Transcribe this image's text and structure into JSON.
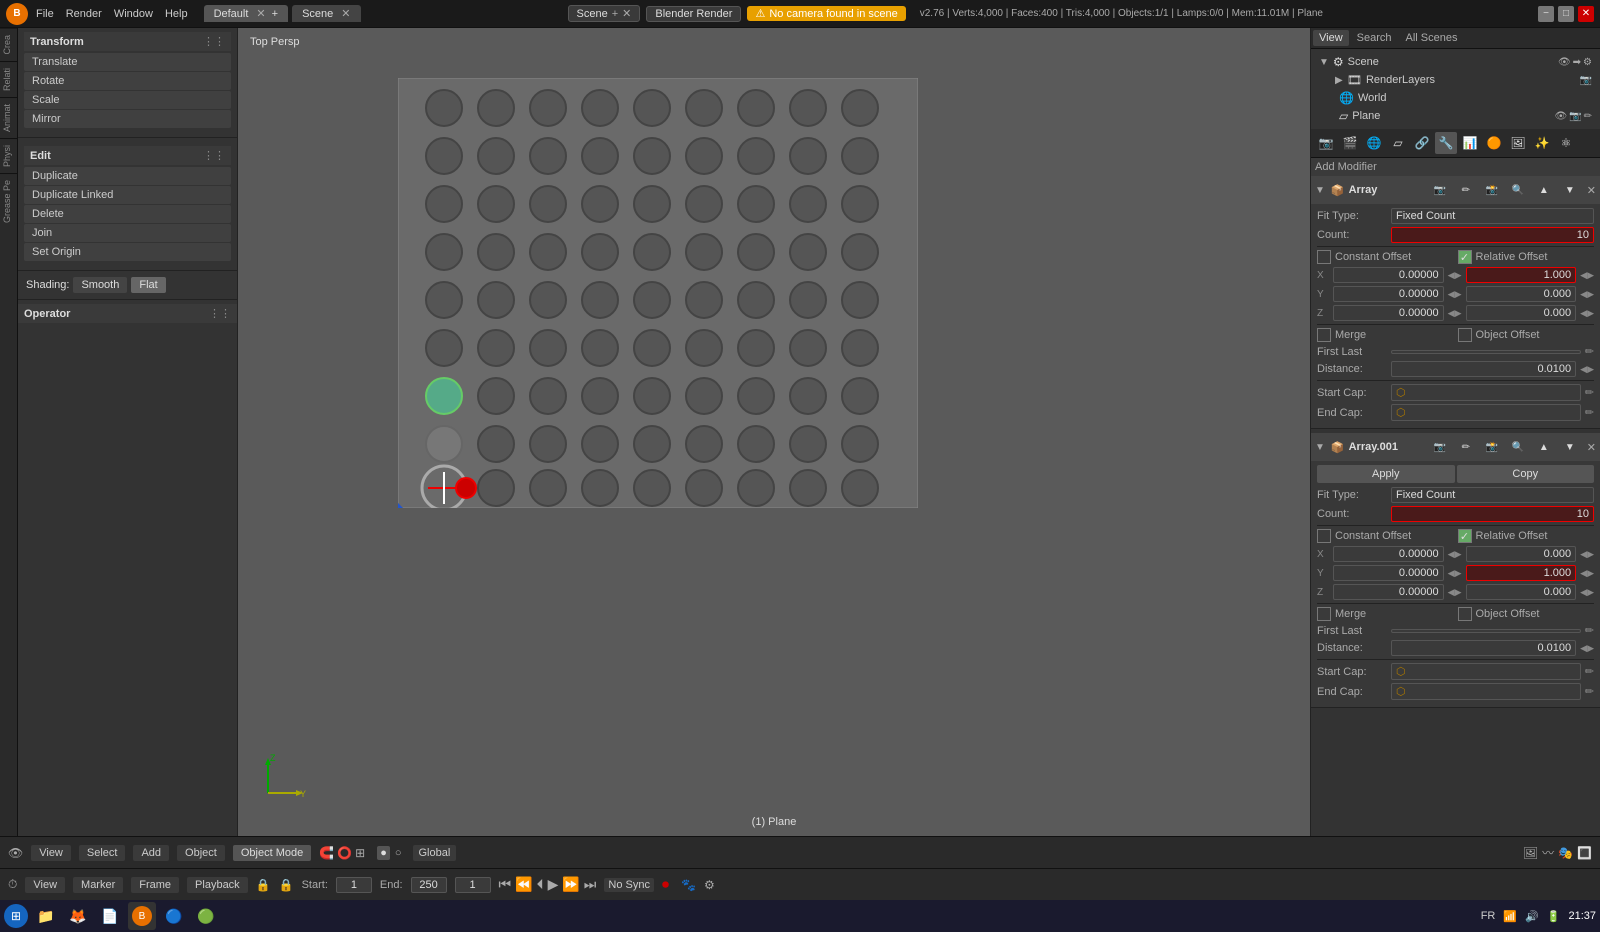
{
  "topbar": {
    "logo": "B",
    "menu_items": [
      "File",
      "Render",
      "Window",
      "Help"
    ],
    "tabs": [
      {
        "label": "Default",
        "active": true
      },
      {
        "label": "Scene",
        "active": false
      }
    ],
    "render_engine": "Blender Render",
    "warning": "No camera found in scene",
    "info": "v2.76 | Verts:4,000 | Faces:400 | Tris:4,000 | Objects:1/1 | Lamps:0/0 | Mem:11.01M | Plane",
    "win_buttons": [
      "−",
      "□",
      "✕"
    ]
  },
  "right_top": {
    "tabs": [
      "View",
      "Search",
      "All Scenes"
    ]
  },
  "scene_tree": {
    "items": [
      {
        "label": "Scene",
        "icon": "🎬",
        "level": 0
      },
      {
        "label": "RenderLayers",
        "icon": "📷",
        "level": 1
      },
      {
        "label": "World",
        "icon": "🌐",
        "level": 1
      },
      {
        "label": "Plane",
        "icon": "▱",
        "level": 1
      }
    ]
  },
  "left_panel": {
    "transform_header": "Transform",
    "transform_items": [
      "Translate",
      "Rotate",
      "Scale",
      "Mirror"
    ],
    "edit_header": "Edit",
    "edit_items": [
      "Duplicate",
      "Duplicate Linked",
      "Delete",
      "Join",
      "Set Origin"
    ],
    "shading": {
      "label": "Shading:",
      "buttons": [
        "Smooth",
        "Flat"
      ]
    },
    "operator_header": "Operator",
    "side_tabs": [
      "Crea",
      "Relati",
      "Animat",
      "Physi",
      "Grease Pe"
    ]
  },
  "viewport": {
    "label": "Top Persp",
    "object_name": "(1) Plane"
  },
  "array_modifier_1": {
    "name": "Array",
    "fit_type_label": "Fit Type:",
    "fit_type_value": "Fixed Count",
    "count_label": "Count:",
    "count_value": "10",
    "constant_offset_label": "Constant Offset",
    "relative_offset_label": "Relative Offset",
    "relative_offset_checked": true,
    "x_label": "X",
    "x_val": "0.00000",
    "x_right": "1.000",
    "y_label": "Y",
    "y_val": "0.00000",
    "y_right": "0.000",
    "z_label": "Z",
    "z_val": "0.00000",
    "z_right": "0.000",
    "merge_label": "Merge",
    "object_offset_label": "Object Offset",
    "first_last_label": "First Last",
    "distance_label": "Distance:",
    "distance_val": "0.0100",
    "start_cap_label": "Start Cap:",
    "end_cap_label": "End Cap:"
  },
  "array_modifier_2": {
    "name": "Array.001",
    "apply_label": "Apply",
    "copy_label": "Copy",
    "fit_type_label": "Fit Type:",
    "fit_type_value": "Fixed Count",
    "count_label": "Count:",
    "count_value": "10",
    "constant_offset_label": "Constant Offset",
    "relative_offset_label": "Relative Offset",
    "relative_offset_checked": true,
    "x_label": "X",
    "x_val": "0.00000",
    "x_right": "0.000",
    "y_label": "Y",
    "y_val": "0.00000",
    "y_right": "1.000",
    "z_label": "Z",
    "z_val": "0.00000",
    "z_right": "0.000",
    "merge_label": "Merge",
    "object_offset_label": "Object Offset",
    "first_last_label": "First Last",
    "distance_label": "Distance:",
    "distance_val": "0.0100",
    "start_cap_label": "Start Cap:",
    "end_cap_label": "End Cap:"
  },
  "bottom_bar": {
    "icon_view": "👁",
    "view_label": "View",
    "select_label": "Select",
    "add_label": "Add",
    "object_label": "Object",
    "mode": "Object Mode",
    "pivot": "Global",
    "object_name": "(1) Plane"
  },
  "timeline": {
    "view_label": "View",
    "marker_label": "Marker",
    "frame_label": "Frame",
    "playback_label": "Playback",
    "start_label": "Start:",
    "start_val": "1",
    "end_label": "End:",
    "end_val": "250",
    "current_frame": "1",
    "sync_label": "No Sync",
    "controls": [
      "⏮",
      "⏪",
      "⏴",
      "▶",
      "⏩",
      "⏭"
    ]
  },
  "taskbar": {
    "apps": [
      "🪟",
      "📁",
      "🦊",
      "📄",
      "🔵",
      "🟢",
      "🔴"
    ],
    "time": "21:37",
    "locale": "FR"
  }
}
